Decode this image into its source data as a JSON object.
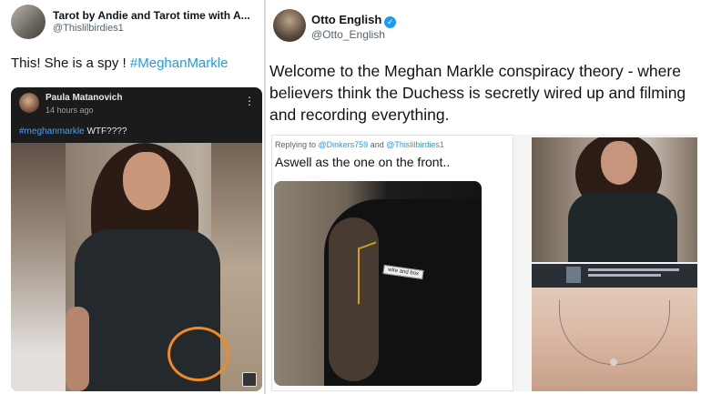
{
  "left_tweet": {
    "display_name": "Tarot by Andie and Tarot time with A...",
    "handle": "@Thislilbirdies1",
    "text": "This!  She is a spy ! ",
    "hashtag": "#MeghanMarkle",
    "facebook_post": {
      "author": "Paula Matanovich",
      "time": "14 hours ago",
      "menu_icon": "more-vertical-icon",
      "hashtag": "#meghanmarkle",
      "text": " WTF????",
      "annotation_color": "#f08a24"
    }
  },
  "right_tweet": {
    "display_name": "Otto English",
    "handle": "@Otto_English",
    "verified_icon": "verified-badge-icon",
    "text": "Welcome to the Meghan Markle conspiracy theory - where believers think the Duchess is secretly wired up and filming and recording everything.",
    "embedded": {
      "replying_prefix": "Replying to ",
      "reply_user_1": "@Dinkers759",
      "reply_and": " and ",
      "reply_user_2": "@Thislilbirdies1",
      "reply_text": "Aswell as the one on the front..",
      "photo_label": "wire and box"
    }
  },
  "colors": {
    "link": "#1d9bf0",
    "verified": "#1d9bf0",
    "divider": "#d9d9d9"
  }
}
